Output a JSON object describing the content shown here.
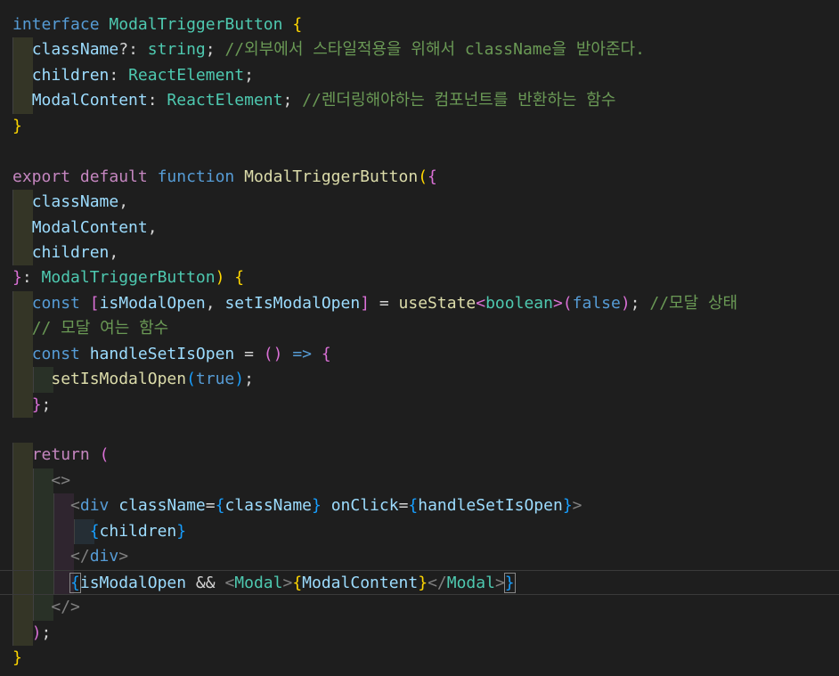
{
  "lines": [
    {
      "indent": 0,
      "tokens": [
        {
          "t": "interface",
          "c": "kw"
        },
        {
          "t": " ",
          "c": "pun"
        },
        {
          "t": "ModalTriggerButton",
          "c": "typ"
        },
        {
          "t": " ",
          "c": "pun"
        },
        {
          "t": "{",
          "c": "bk1"
        }
      ]
    },
    {
      "indent": 1,
      "tokens": [
        {
          "t": "className",
          "c": "var"
        },
        {
          "t": "?: ",
          "c": "pun"
        },
        {
          "t": "string",
          "c": "typ"
        },
        {
          "t": "; ",
          "c": "pun"
        },
        {
          "t": "//외부에서 스타일적용을 위해서 className을 받아준다.",
          "c": "cm"
        }
      ]
    },
    {
      "indent": 1,
      "tokens": [
        {
          "t": "children",
          "c": "var"
        },
        {
          "t": ": ",
          "c": "pun"
        },
        {
          "t": "ReactElement",
          "c": "typ"
        },
        {
          "t": ";",
          "c": "pun"
        }
      ]
    },
    {
      "indent": 1,
      "tokens": [
        {
          "t": "ModalContent",
          "c": "var"
        },
        {
          "t": ": ",
          "c": "pun"
        },
        {
          "t": "ReactElement",
          "c": "typ"
        },
        {
          "t": "; ",
          "c": "pun"
        },
        {
          "t": "//렌더링해야하는 컴포넌트를 반환하는 함수",
          "c": "cm"
        }
      ]
    },
    {
      "indent": 0,
      "tokens": [
        {
          "t": "}",
          "c": "bk1"
        }
      ]
    },
    {
      "indent": 0,
      "tokens": []
    },
    {
      "indent": 0,
      "tokens": [
        {
          "t": "export",
          "c": "ctl"
        },
        {
          "t": " ",
          "c": "pun"
        },
        {
          "t": "default",
          "c": "ctl"
        },
        {
          "t": " ",
          "c": "pun"
        },
        {
          "t": "function",
          "c": "kw"
        },
        {
          "t": " ",
          "c": "pun"
        },
        {
          "t": "ModalTriggerButton",
          "c": "fn"
        },
        {
          "t": "(",
          "c": "bk1"
        },
        {
          "t": "{",
          "c": "bk2"
        }
      ]
    },
    {
      "indent": 1,
      "tokens": [
        {
          "t": "className",
          "c": "var"
        },
        {
          "t": ",",
          "c": "pun"
        }
      ]
    },
    {
      "indent": 1,
      "tokens": [
        {
          "t": "ModalContent",
          "c": "var"
        },
        {
          "t": ",",
          "c": "pun"
        }
      ]
    },
    {
      "indent": 1,
      "tokens": [
        {
          "t": "children",
          "c": "var"
        },
        {
          "t": ",",
          "c": "pun"
        }
      ]
    },
    {
      "indent": 0,
      "tokens": [
        {
          "t": "}",
          "c": "bk2"
        },
        {
          "t": ": ",
          "c": "pun"
        },
        {
          "t": "ModalTriggerButton",
          "c": "typ"
        },
        {
          "t": ")",
          "c": "bk1"
        },
        {
          "t": " ",
          "c": "pun"
        },
        {
          "t": "{",
          "c": "bk1"
        }
      ]
    },
    {
      "indent": 1,
      "tokens": [
        {
          "t": "const",
          "c": "kw"
        },
        {
          "t": " ",
          "c": "pun"
        },
        {
          "t": "[",
          "c": "bk2"
        },
        {
          "t": "isModalOpen",
          "c": "var"
        },
        {
          "t": ", ",
          "c": "pun"
        },
        {
          "t": "setIsModalOpen",
          "c": "var"
        },
        {
          "t": "]",
          "c": "bk2"
        },
        {
          "t": " = ",
          "c": "pun"
        },
        {
          "t": "useState",
          "c": "fn"
        },
        {
          "t": "<",
          "c": "bk2"
        },
        {
          "t": "boolean",
          "c": "typ"
        },
        {
          "t": ">",
          "c": "bk2"
        },
        {
          "t": "(",
          "c": "bk2"
        },
        {
          "t": "false",
          "c": "kw"
        },
        {
          "t": ")",
          "c": "bk2"
        },
        {
          "t": "; ",
          "c": "pun"
        },
        {
          "t": "//모달 상태",
          "c": "cm"
        }
      ]
    },
    {
      "indent": 1,
      "tokens": [
        {
          "t": "// 모달 여는 함수",
          "c": "cm"
        }
      ]
    },
    {
      "indent": 1,
      "tokens": [
        {
          "t": "const",
          "c": "kw"
        },
        {
          "t": " ",
          "c": "pun"
        },
        {
          "t": "handleSetIsOpen",
          "c": "var"
        },
        {
          "t": " = ",
          "c": "pun"
        },
        {
          "t": "()",
          "c": "bk2"
        },
        {
          "t": " ",
          "c": "pun"
        },
        {
          "t": "=>",
          "c": "kw"
        },
        {
          "t": " ",
          "c": "pun"
        },
        {
          "t": "{",
          "c": "bk2"
        }
      ]
    },
    {
      "indent": 2,
      "tokens": [
        {
          "t": "setIsModalOpen",
          "c": "fn"
        },
        {
          "t": "(",
          "c": "bk3"
        },
        {
          "t": "true",
          "c": "kw"
        },
        {
          "t": ")",
          "c": "bk3"
        },
        {
          "t": ";",
          "c": "pun"
        }
      ]
    },
    {
      "indent": 1,
      "tokens": [
        {
          "t": "}",
          "c": "bk2"
        },
        {
          "t": ";",
          "c": "pun"
        }
      ]
    },
    {
      "indent": 0,
      "tokens": []
    },
    {
      "indent": 1,
      "tokens": [
        {
          "t": "return",
          "c": "ctl"
        },
        {
          "t": " ",
          "c": "pun"
        },
        {
          "t": "(",
          "c": "bk2"
        }
      ]
    },
    {
      "indent": 2,
      "tokens": [
        {
          "t": "<>",
          "c": "tag"
        }
      ]
    },
    {
      "indent": 3,
      "tokens": [
        {
          "t": "<",
          "c": "tag"
        },
        {
          "t": "div",
          "c": "tn"
        },
        {
          "t": " ",
          "c": "pun"
        },
        {
          "t": "className",
          "c": "var"
        },
        {
          "t": "=",
          "c": "pun"
        },
        {
          "t": "{",
          "c": "bk3"
        },
        {
          "t": "className",
          "c": "var"
        },
        {
          "t": "}",
          "c": "bk3"
        },
        {
          "t": " ",
          "c": "pun"
        },
        {
          "t": "onClick",
          "c": "var"
        },
        {
          "t": "=",
          "c": "pun"
        },
        {
          "t": "{",
          "c": "bk3"
        },
        {
          "t": "handleSetIsOpen",
          "c": "var"
        },
        {
          "t": "}",
          "c": "bk3"
        },
        {
          "t": ">",
          "c": "tag"
        }
      ]
    },
    {
      "indent": 4,
      "tokens": [
        {
          "t": "{",
          "c": "bk3"
        },
        {
          "t": "children",
          "c": "var"
        },
        {
          "t": "}",
          "c": "bk3"
        }
      ]
    },
    {
      "indent": 3,
      "tokens": [
        {
          "t": "</",
          "c": "tag"
        },
        {
          "t": "div",
          "c": "tn"
        },
        {
          "t": ">",
          "c": "tag"
        }
      ]
    },
    {
      "indent": 3,
      "cursor": true,
      "tokens": [
        {
          "t": "{",
          "c": "bk3 bx"
        },
        {
          "t": "isModalOpen",
          "c": "var"
        },
        {
          "t": " && ",
          "c": "pun"
        },
        {
          "t": "<",
          "c": "tag"
        },
        {
          "t": "Modal",
          "c": "typ"
        },
        {
          "t": ">",
          "c": "tag"
        },
        {
          "t": "{",
          "c": "bk1"
        },
        {
          "t": "ModalContent",
          "c": "var"
        },
        {
          "t": "}",
          "c": "bk1"
        },
        {
          "t": "</",
          "c": "tag"
        },
        {
          "t": "Modal",
          "c": "typ"
        },
        {
          "t": ">",
          "c": "tag"
        },
        {
          "t": "}",
          "c": "bk3 bx"
        }
      ]
    },
    {
      "indent": 2,
      "tokens": [
        {
          "t": "</>",
          "c": "tag"
        }
      ]
    },
    {
      "indent": 1,
      "tokens": [
        {
          "t": ")",
          "c": "bk2"
        },
        {
          "t": ";",
          "c": "pun"
        }
      ]
    },
    {
      "indent": 0,
      "tokens": [
        {
          "t": "}",
          "c": "bk1"
        }
      ]
    }
  ]
}
